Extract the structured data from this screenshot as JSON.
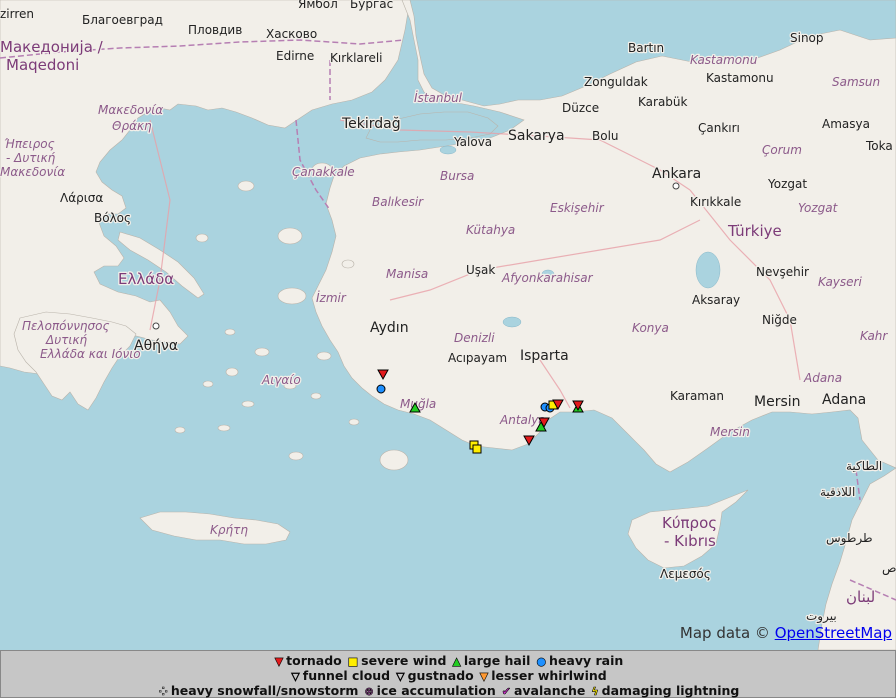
{
  "map": {
    "labels": {
      "kirklareli": "Kırklareli",
      "edirne": "Edirne",
      "bulgaria_city": "Благоевград",
      "plovdiv": "Пловдив",
      "haskovo": "Хасково",
      "yambol": "Ямбол",
      "burgas": "Бургас",
      "kyustendil": "zirren",
      "macedonia": "Македонија /",
      "macedonia2": "Maqedoni",
      "makedonia_gr": "Μακεδονία",
      "thraki": "Θράκη",
      "ipeiros1": "Ήπειρος",
      "ipeiros2": "- Δυτική",
      "ipeiros3": "Μακεδονία",
      "larisa": "Λάρισα",
      "volos": "Βόλος",
      "ellada": "Ελλάδα",
      "peloponnisos1": "Πελοπόννησος",
      "peloponnisos2": "Δυτική",
      "peloponnisos3": "Ελλάδα και Ιόνιο",
      "athina": "Αθήνα",
      "aigaio": "Αιγαίο",
      "kriti": "Κρήτη",
      "tekirdag": "Tekirdağ",
      "istanbul": "İstanbul",
      "yalova": "Yalova",
      "sakarya": "Sakarya",
      "duzce": "Düzce",
      "bolu": "Bolu",
      "zonguldak": "Zonguldak",
      "bartin": "Bartın",
      "karabuk": "Karabük",
      "kastamonu_r": "Kastamonu",
      "kastamonu": "Kastamonu",
      "sinop": "Sinop",
      "samsun": "Samsun",
      "cankiri": "Çankırı",
      "amasya": "Amasya",
      "corum": "Çorum",
      "tokat": "Toka",
      "canakkale": "Çanakkale",
      "bursa": "Bursa",
      "balikesir": "Balıkesir",
      "eskisehir": "Eskişehir",
      "kutahya": "Kütahya",
      "ankara": "Ankara",
      "kirikkale": "Kırıkkale",
      "yozgat": "Yozgat",
      "yozgat_r": "Yozgat",
      "turkiye": "Türkiye",
      "manisa": "Manisa",
      "usak": "Uşak",
      "afyon": "Afyonkarahisar",
      "izmir": "İzmir",
      "aydin": "Aydın",
      "denizli": "Denizli",
      "acipayam": "Acıpayam",
      "isparta": "Isparta",
      "konya": "Konya",
      "nevsehir": "Nevşehir",
      "kayseri": "Kayseri",
      "aksaray": "Aksaray",
      "nigde": "Niğde",
      "mugla": "Muğla",
      "antalya": "Antalya",
      "karaman": "Karaman",
      "mersin": "Mersin",
      "mersin_r": "Mersin",
      "adana": "Adana",
      "adana_r": "Adana",
      "kahraman": "Kahr",
      "kypros1": "Κύπρος",
      "kypros2": "- Kıbrıs",
      "lemesos": "Λεμεσός",
      "ar1": "اللاذقية",
      "ar2": "طرطوس",
      "ar3": "بيروت",
      "ar4": "لبنان",
      "ar5": "الطاكية",
      "ar6": "ص"
    },
    "marker_colors": {
      "tornado": "#e31a1c",
      "severe_wind": "#ffee00",
      "large_hail": "#22cc22",
      "heavy_rain": "#1e90ff"
    }
  },
  "attribution": {
    "prefix": "Map data ©",
    "link": "OpenStreetMap"
  },
  "legend": {
    "row1": [
      {
        "symbol": "▼",
        "color": "#e31a1c",
        "label": "tornado"
      },
      {
        "symbol": "■",
        "color": "#ffee00",
        "label": "severe wind"
      },
      {
        "symbol": "▲",
        "color": "#22cc22",
        "label": "large hail"
      },
      {
        "symbol": "●",
        "color": "#1e90ff",
        "label": "heavy rain"
      }
    ],
    "row2": [
      {
        "symbol": "▽",
        "color": "#ffffff",
        "label": "funnel cloud"
      },
      {
        "symbol": "▽",
        "color": "#cc66cc",
        "label": "gustnado"
      },
      {
        "symbol": "▼",
        "color": "#ff9933",
        "label": "lesser whirlwind"
      }
    ],
    "row3": [
      {
        "symbol": "⁘",
        "color": "#ffffff",
        "label": "heavy snowfall/snowstorm"
      },
      {
        "symbol": "⊗",
        "color": "#cc66cc",
        "label": "ice accumulation"
      },
      {
        "symbol": "✔",
        "color": "#cc33cc",
        "label": "avalanche"
      },
      {
        "symbol": "ϟ",
        "color": "#ffee00",
        "label": "damaging lightning"
      }
    ]
  }
}
